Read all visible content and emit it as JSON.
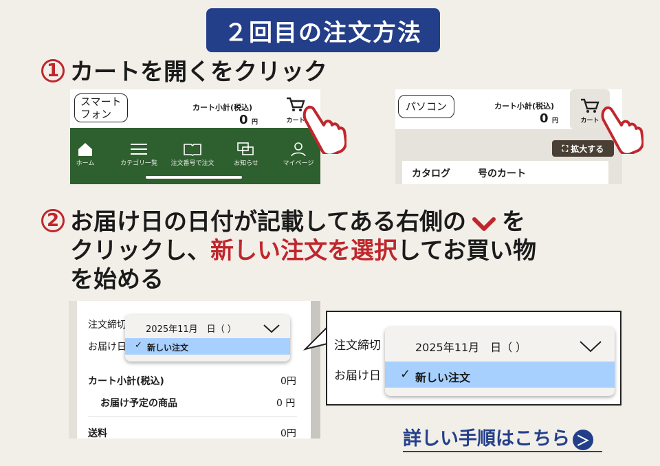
{
  "header": {
    "title": "２回目の注文方法"
  },
  "step1": {
    "number": "1",
    "text": "カートを開くをクリック"
  },
  "step2": {
    "number": "2",
    "line1_a": "お届け日の日付が記載してある右側の",
    "line1_b": "を",
    "line2_a": "クリックし、",
    "line2_red": "新しい注文を選択",
    "line2_b": "してお買い物",
    "line3": "を始める"
  },
  "phone": {
    "label_line1": "スマート",
    "label_line2": "フォン",
    "subtotal_label": "カート小計(税込)",
    "subtotal_value": "0",
    "yen": "円",
    "cart_label": "カート",
    "nav": [
      "ホーム",
      "カテゴリ一覧",
      "注文番号で注文",
      "お知らせ",
      "マイページ"
    ]
  },
  "pc": {
    "label": "パソコン",
    "subtotal_label": "カート小計(税込)",
    "subtotal_value": "0",
    "yen": "円",
    "cart_label": "カート",
    "zoom_label": "拡大する",
    "catalog_label": "カタログ",
    "catalog_cart": "号のカート"
  },
  "order": {
    "deadline_label": "注文締切",
    "delivery_label": "お届け日",
    "dropdown_date": "2025年11月　日（ ）",
    "dropdown_option": "新しい注文",
    "check": "✓",
    "cart_subtotal_label": "カート小計(税込)",
    "cart_subtotal_value": "0円",
    "scheduled_label": "お届け予定の商品",
    "scheduled_value": "0 円",
    "shipping_label": "送料",
    "shipping_value": "0円"
  },
  "zoom": {
    "deadline_label": "注文締切",
    "delivery_label": "お届け日",
    "dropdown_date": "2025年11月　日（ ）",
    "dropdown_option": "新しい注文",
    "check": "✓"
  },
  "link": {
    "text": "詳しい手順はこちら",
    "arrow": "＞"
  }
}
